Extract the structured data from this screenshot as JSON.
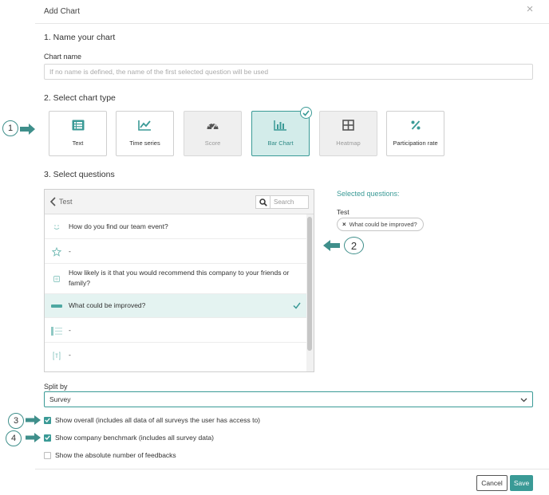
{
  "dialog": {
    "title": "Add Chart"
  },
  "section1": {
    "heading": "1. Name your chart",
    "field_label": "Chart name",
    "placeholder": "If no name is defined, the name of the first selected question will be used",
    "value": ""
  },
  "section2": {
    "heading": "2. Select chart type",
    "types": [
      {
        "label": "Text",
        "icon": "list-icon",
        "state": "normal"
      },
      {
        "label": "Time series",
        "icon": "line-chart-icon",
        "state": "normal"
      },
      {
        "label": "Score",
        "icon": "gauge-icon",
        "state": "disabled"
      },
      {
        "label": "Bar Chart",
        "icon": "bar-chart-icon",
        "state": "selected"
      },
      {
        "label": "Heatmap",
        "icon": "grid-icon",
        "state": "disabled"
      },
      {
        "label": "Participation rate",
        "icon": "percent-icon",
        "state": "normal"
      }
    ]
  },
  "section3": {
    "heading": "3. Select questions",
    "folder": "Test",
    "search_placeholder": "Search",
    "questions": [
      {
        "text": "How do you find our team event?",
        "icon": "smiley-icon",
        "selected": false
      },
      {
        "text": "-",
        "icon": "star-icon",
        "selected": false
      },
      {
        "text": "How likely is it that you would recommend this company to your friends or family?",
        "icon": "nps-icon",
        "selected": false
      },
      {
        "text": "What could be improved?",
        "icon": "text-field-icon",
        "selected": true
      },
      {
        "text": "-",
        "icon": "matrix-icon",
        "selected": false
      },
      {
        "text": "-",
        "icon": "text-box-icon",
        "selected": false
      }
    ],
    "selected_heading": "Selected questions:",
    "selected_folder": "Test",
    "selected_chip": "What could be improved?"
  },
  "split": {
    "label": "Split by",
    "value": "Survey"
  },
  "options": [
    {
      "label": "Show overall (includes all data of all surveys the user has access to)",
      "checked": true
    },
    {
      "label": "Show company benchmark (includes all survey data)",
      "checked": true
    },
    {
      "label": "Show the absolute number of feedbacks",
      "checked": false
    }
  ],
  "callouts": [
    "1",
    "2",
    "3",
    "4"
  ],
  "buttons": {
    "cancel": "Cancel",
    "save": "Save"
  },
  "colors": {
    "accent": "#3a9a96",
    "selected_bg": "#d3ecea",
    "row_selected_bg": "#e4f3f1",
    "arrow": "#3f8f8b"
  }
}
